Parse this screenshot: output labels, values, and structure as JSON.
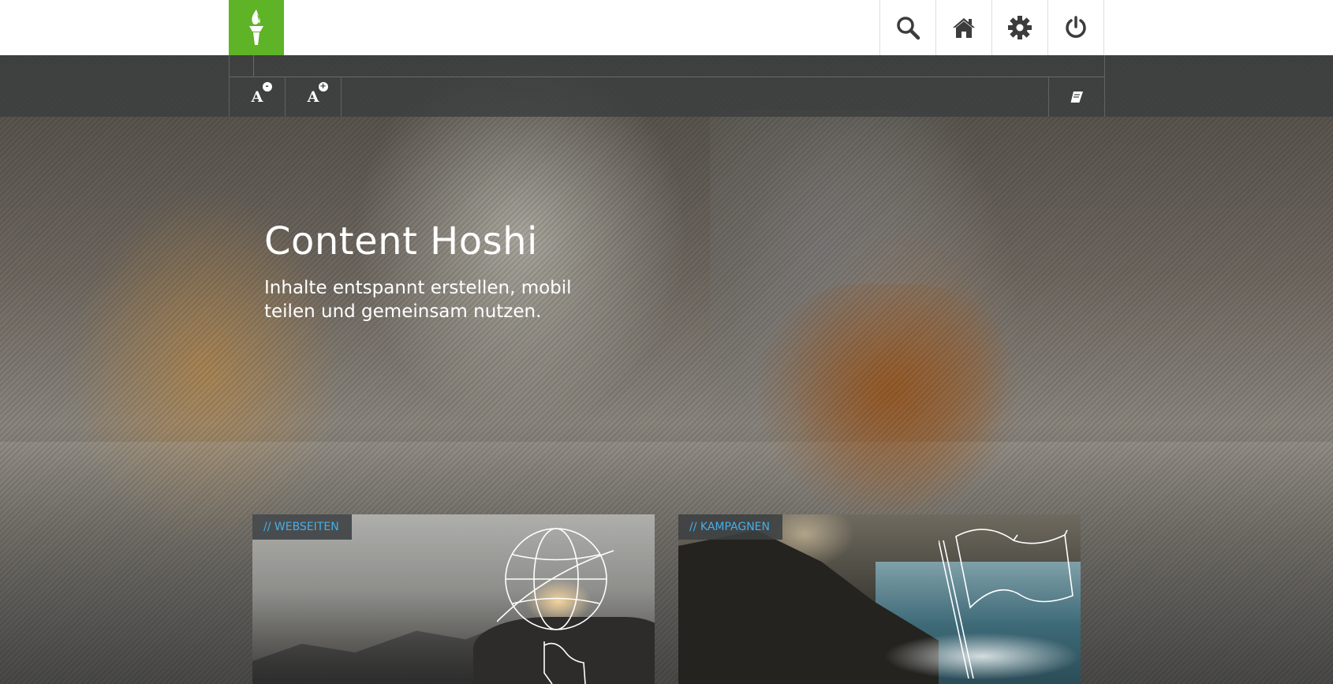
{
  "header": {
    "logo_icon": "torch-icon",
    "brand_color": "#5fb327",
    "actions": [
      {
        "name": "search",
        "icon": "search-icon"
      },
      {
        "name": "home",
        "icon": "home-icon"
      },
      {
        "name": "settings",
        "icon": "gear-icon"
      },
      {
        "name": "logout",
        "icon": "power-icon"
      }
    ]
  },
  "toolbar": {
    "font_decrease": {
      "letter": "A",
      "badge": "-"
    },
    "font_increase": {
      "letter": "A",
      "badge": "+"
    },
    "book_icon": "book-icon"
  },
  "hero": {
    "title": "Content Hoshi",
    "subtitle": "Inhalte entspannt erstellen, mobil teilen und gemeinsam nutzen."
  },
  "cards": [
    {
      "tag": "// WEBSEITEN",
      "icon": "globe-pointer-icon"
    },
    {
      "tag": "// KAMPAGNEN",
      "icon": "flag-icon"
    }
  ],
  "colors": {
    "tag_text": "#47aee6",
    "toolbar_bg": "#3a3e3e"
  }
}
